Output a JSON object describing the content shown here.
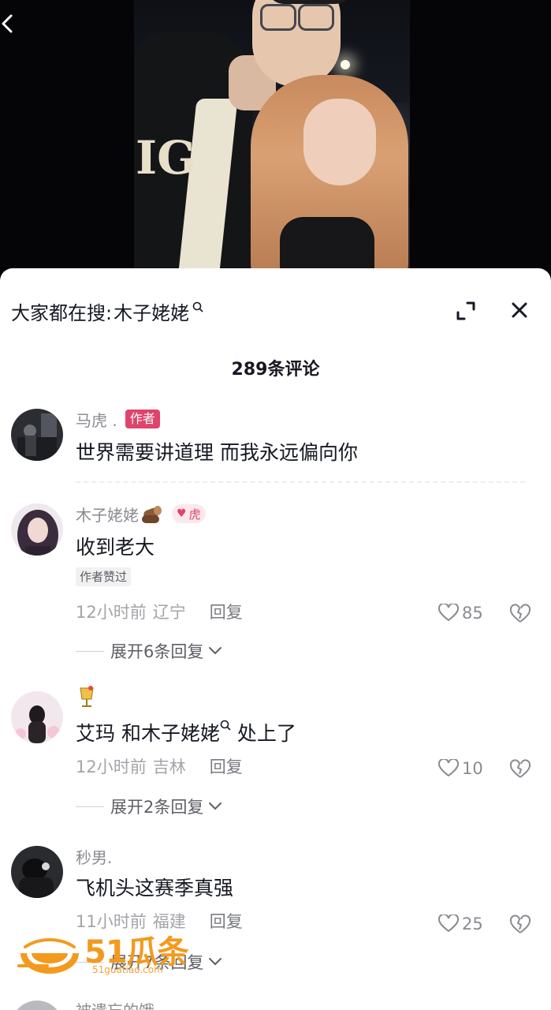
{
  "header": {
    "search_prefix": "大家都在搜:",
    "search_term": "木子姥姥"
  },
  "comments_header": {
    "count_label": "289条评论"
  },
  "comments": [
    {
      "username": "马虎 .",
      "badge": "作者",
      "text": "世界需要讲道理 而我永远偏向你"
    },
    {
      "username": "木子姥姥",
      "fan_badge": "虎",
      "text": "收到老大",
      "liked_tag": "作者赞过",
      "time": "12小时前",
      "location": "辽宁",
      "reply": "回复",
      "likes": "85",
      "expand": "展开6条回复"
    },
    {
      "username": "",
      "text_part1": "艾玛 和",
      "text_mention": "木子姥姥",
      "text_part2": " 处上了",
      "time": "12小时前",
      "location": "吉林",
      "reply": "回复",
      "likes": "10",
      "expand": "展开2条回复"
    },
    {
      "username": "秒男.",
      "text": "飞机头这赛季真强",
      "time": "11小时前",
      "location": "福建",
      "reply": "回复",
      "likes": "25",
      "expand": "展开7条回复"
    },
    {
      "username": "被遗忘的饿"
    }
  ],
  "watermark": {
    "brand": "51瓜条",
    "url": "51guatiao.com"
  },
  "colors": {
    "accent": "#e0436b",
    "text_primary": "#161823",
    "text_secondary": "#8a8b91"
  }
}
